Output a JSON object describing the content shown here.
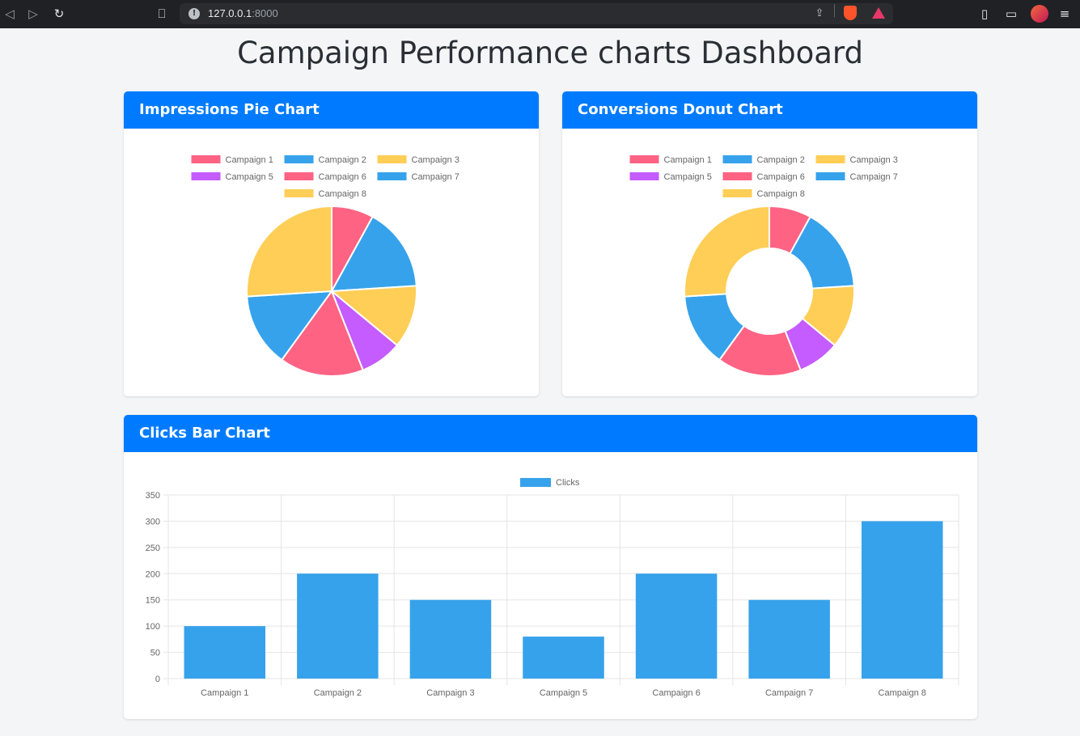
{
  "browser": {
    "url_host": "127.0.0.1",
    "url_port": ":8000"
  },
  "page": {
    "title": "Campaign Performance charts Dashboard"
  },
  "colors": {
    "header": "#007bff",
    "pink": "#ff6384",
    "blue": "#36a2eb",
    "yellow": "#ffce56",
    "purple": "#c45cff"
  },
  "cards": {
    "pie": {
      "header": "Impressions Pie Chart"
    },
    "donut": {
      "header": "Conversions Donut Chart"
    },
    "bar": {
      "header": "Clicks Bar Chart"
    }
  },
  "chart_data": [
    {
      "type": "pie",
      "labels": [
        "Campaign 1",
        "Campaign 2",
        "Campaign 3",
        "Campaign 5",
        "Campaign 6",
        "Campaign 7",
        "Campaign 8"
      ],
      "values": [
        8,
        16,
        12,
        8,
        16,
        14,
        26
      ],
      "colors": [
        "#ff6384",
        "#36a2eb",
        "#ffce56",
        "#c45cff",
        "#ff6384",
        "#36a2eb",
        "#ffce56"
      ],
      "legend": "top"
    },
    {
      "type": "pie",
      "donut": true,
      "labels": [
        "Campaign 1",
        "Campaign 2",
        "Campaign 3",
        "Campaign 5",
        "Campaign 6",
        "Campaign 7",
        "Campaign 8"
      ],
      "values": [
        8,
        16,
        12,
        8,
        16,
        14,
        26
      ],
      "colors": [
        "#ff6384",
        "#36a2eb",
        "#ffce56",
        "#c45cff",
        "#ff6384",
        "#36a2eb",
        "#ffce56"
      ],
      "legend": "top"
    },
    {
      "type": "bar",
      "categories": [
        "Campaign 1",
        "Campaign 2",
        "Campaign 3",
        "Campaign 5",
        "Campaign 6",
        "Campaign 7",
        "Campaign 8"
      ],
      "series": [
        {
          "name": "Clicks",
          "values": [
            100,
            200,
            150,
            80,
            200,
            150,
            300
          ],
          "color": "#36a2eb"
        }
      ],
      "ylim": [
        0,
        350
      ],
      "yticks": [
        "0",
        "50",
        "100",
        "150",
        "200",
        "250",
        "300",
        "350"
      ],
      "grid": true,
      "legend": "top"
    }
  ]
}
